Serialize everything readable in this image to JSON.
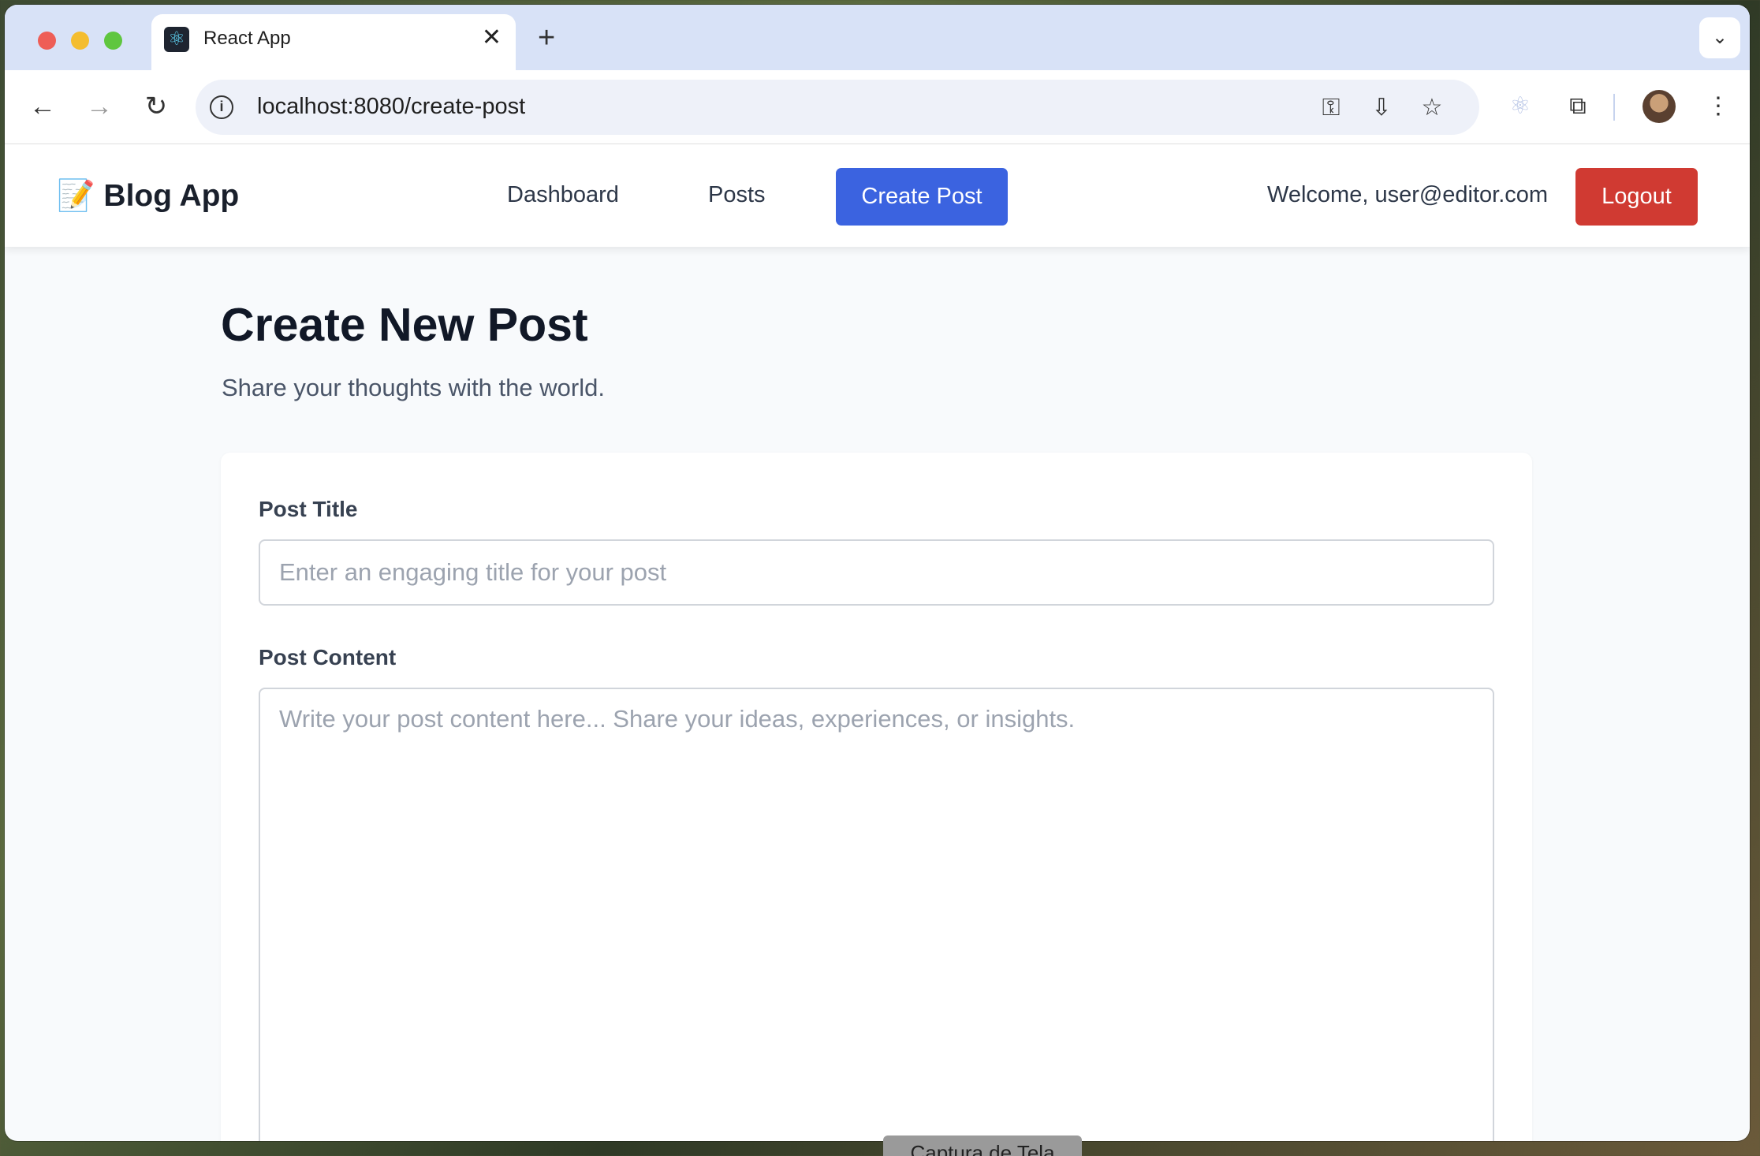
{
  "browser": {
    "tab_title": "React App",
    "tab_close": "✕",
    "new_tab": "+",
    "url": "localhost:8080/create-post",
    "icons": [
      "back-icon",
      "forward-icon",
      "reload-icon",
      "info-icon",
      "key-icon",
      "install-icon",
      "star-icon",
      "react-extension-icon",
      "extensions-icon",
      "menu-icon"
    ]
  },
  "header": {
    "brand_emoji": "📝",
    "brand": "Blog App",
    "nav": {
      "dashboard": "Dashboard",
      "posts": "Posts",
      "create_post": "Create Post"
    },
    "welcome": "Welcome, user@editor.com",
    "logout": "Logout",
    "colors": {
      "primary": "#3b63e0",
      "danger": "#d03a32"
    }
  },
  "main": {
    "title": "Create New Post",
    "subtitle": "Share your thoughts with the world.",
    "form": {
      "title_label": "Post Title",
      "title_value": "",
      "title_placeholder": "Enter an engaging title for your post",
      "content_label": "Post Content",
      "content_value": "",
      "content_placeholder": "Write your post content here... Share your ideas, experiences, or insights."
    }
  },
  "overlay": {
    "toast": "Captura de Tela"
  }
}
